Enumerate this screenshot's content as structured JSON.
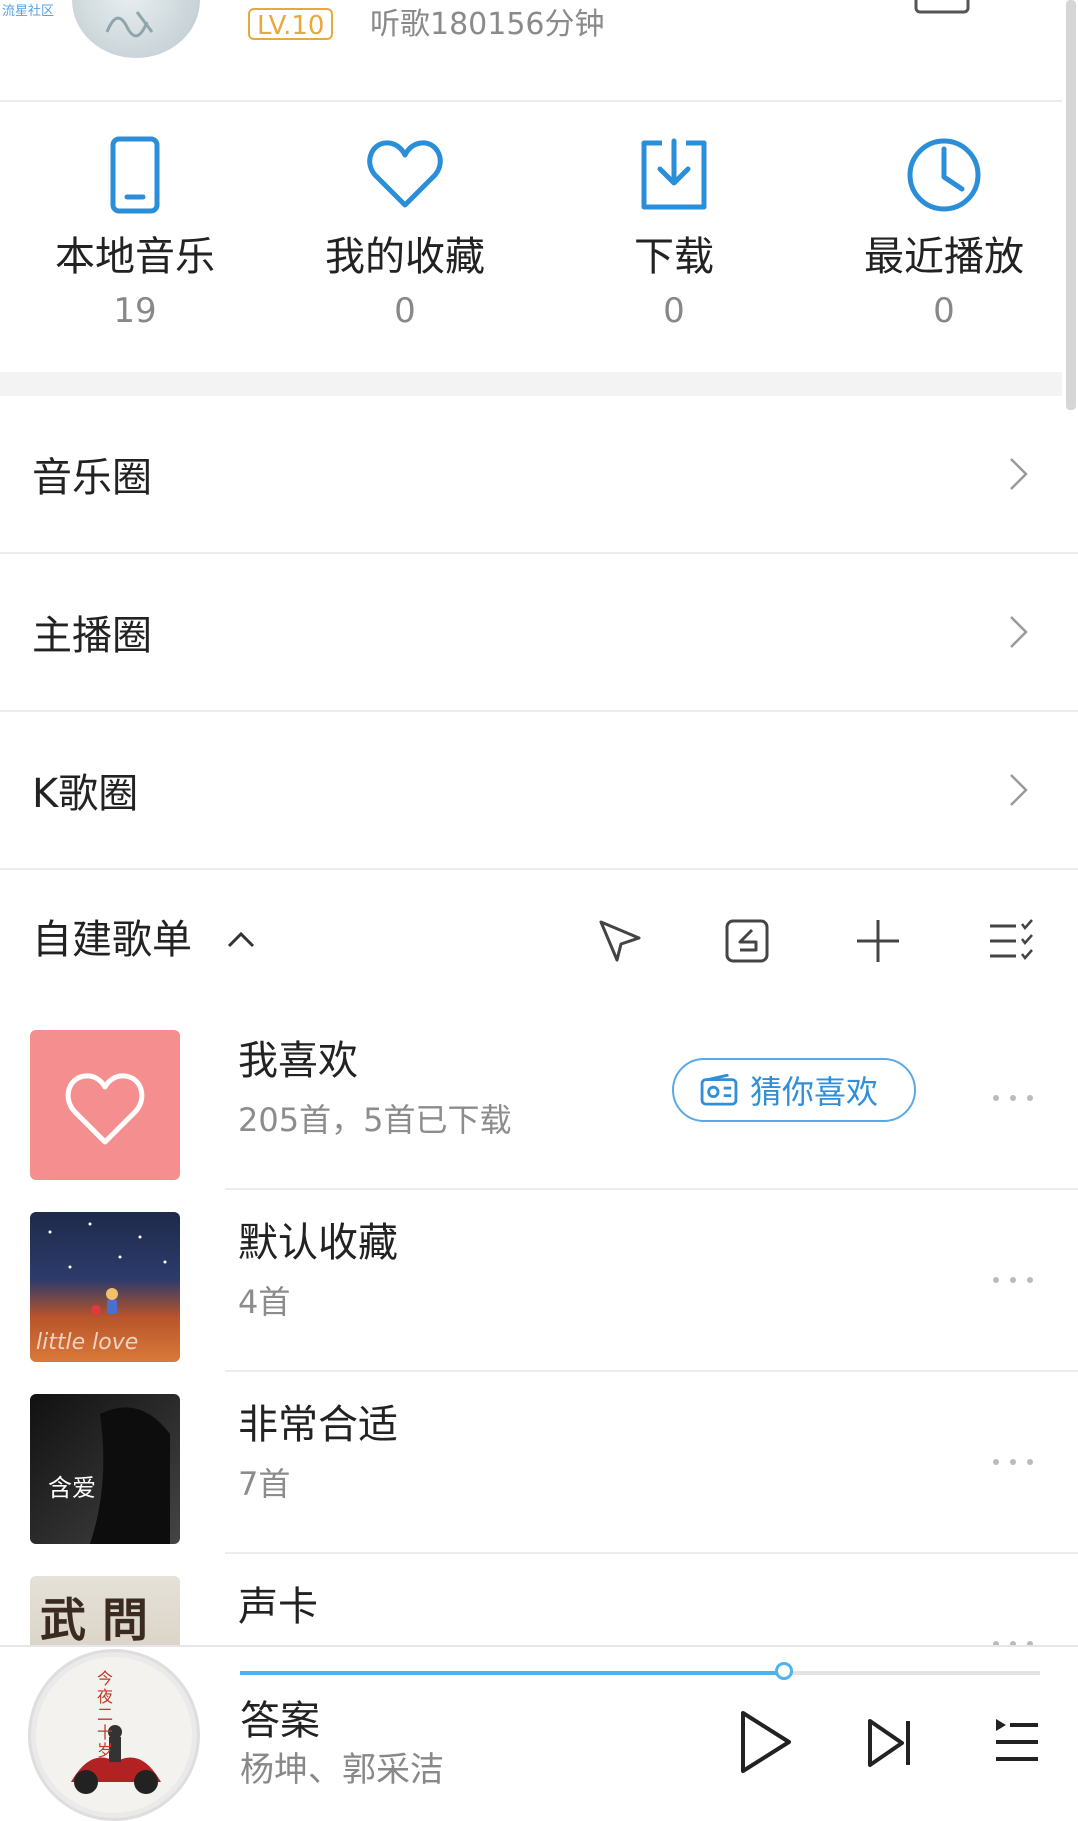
{
  "watermark": "流星社区",
  "profile": {
    "level_badge": "LV.10",
    "listen_time": "听歌180156分钟"
  },
  "quick_access": [
    {
      "icon": "phone-icon",
      "label": "本地音乐",
      "count": "19"
    },
    {
      "icon": "heart-icon",
      "label": "我的收藏",
      "count": "0"
    },
    {
      "icon": "download-icon",
      "label": "下载",
      "count": "0"
    },
    {
      "icon": "clock-icon",
      "label": "最近播放",
      "count": "0"
    }
  ],
  "circles": [
    {
      "label": "音乐圈"
    },
    {
      "label": "主播圈"
    },
    {
      "label": "K歌圈"
    }
  ],
  "playlists_section": {
    "title": "自建歌单",
    "tools": [
      "share-icon",
      "import-icon",
      "add-icon",
      "manage-list-icon"
    ]
  },
  "playlists": [
    {
      "name": "我喜欢",
      "meta": "205首，5首已下载",
      "guess_button": "猜你喜欢"
    },
    {
      "name": "默认收藏",
      "meta": "4首",
      "cover_text": "little love"
    },
    {
      "name": "非常合适",
      "meta": "7首",
      "cover_text": "含爱"
    },
    {
      "name": "声卡",
      "meta": "",
      "cover_text": "武 問道"
    }
  ],
  "player": {
    "title": "答案",
    "artist": "杨坤、郭采洁",
    "progress": 0.68,
    "disc_text": "今夜二十岁"
  },
  "colors": {
    "accent": "#2f8fd8",
    "icon_blue": "#2b8ed8",
    "level_badge": "#e7a93b",
    "favorite_cover": "#f58f8f",
    "progress": "#4fb2ea"
  }
}
